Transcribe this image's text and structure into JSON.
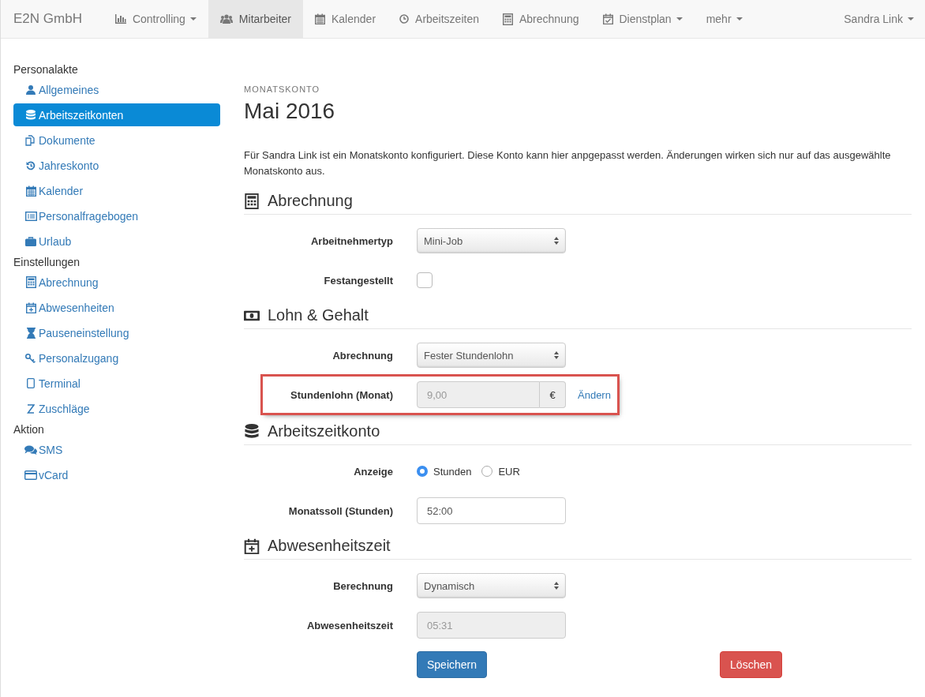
{
  "navbar": {
    "brand": "E2N GmbH",
    "items": [
      {
        "label": "Controlling",
        "dropdown": true,
        "selected": false
      },
      {
        "label": "Mitarbeiter",
        "dropdown": false,
        "selected": true
      },
      {
        "label": "Kalender",
        "dropdown": false,
        "selected": false
      },
      {
        "label": "Arbeitszeiten",
        "dropdown": false,
        "selected": false
      },
      {
        "label": "Abrechnung",
        "dropdown": false,
        "selected": false
      },
      {
        "label": "Dienstplan",
        "dropdown": true,
        "selected": false
      },
      {
        "label": "mehr",
        "dropdown": true,
        "selected": false
      }
    ],
    "user": {
      "label": "Sandra Link",
      "dropdown": true
    }
  },
  "sidebar": [
    {
      "heading": "Personalakte",
      "items": [
        {
          "label": "Allgemeines",
          "selected": false
        },
        {
          "label": "Arbeitszeitkonten",
          "selected": true
        },
        {
          "label": "Dokumente",
          "selected": false
        },
        {
          "label": "Jahreskonto",
          "selected": false
        },
        {
          "label": "Kalender",
          "selected": false
        },
        {
          "label": "Personalfragebogen",
          "selected": false
        },
        {
          "label": "Urlaub",
          "selected": false
        }
      ]
    },
    {
      "heading": "Einstellungen",
      "items": [
        {
          "label": "Abrechnung",
          "selected": false
        },
        {
          "label": "Abwesenheiten",
          "selected": false
        },
        {
          "label": "Pauseneinstellung",
          "selected": false
        },
        {
          "label": "Personalzugang",
          "selected": false
        },
        {
          "label": "Terminal",
          "selected": false
        },
        {
          "label": "Zuschläge",
          "selected": false
        }
      ]
    },
    {
      "heading": "Aktion",
      "items": [
        {
          "label": "SMS",
          "selected": false
        },
        {
          "label": "vCard",
          "selected": false
        }
      ]
    }
  ],
  "page": {
    "overline": "MONATSKONTO",
    "title": "Mai 2016",
    "intro": "Für Sandra Link ist ein Monatskonto konfiguriert. Diese Konto kann hier anpgepasst werden. Änderungen wirken sich nur auf das ausgewählte Monatskonto aus."
  },
  "sections": [
    {
      "title": "Abrechnung",
      "rows": [
        {
          "kind": "select",
          "label": "Arbeitnehmertyp",
          "value": "Mini-Job"
        },
        {
          "kind": "checkbox",
          "label": "Festangestellt",
          "checked": false
        }
      ]
    },
    {
      "title": "Lohn & Gehalt",
      "rows": [
        {
          "kind": "select",
          "label": "Abrechnung",
          "value": "Fester Stundenlohn"
        },
        {
          "kind": "addon",
          "label": "Stundenlohn (Monat)",
          "value": "9,00",
          "addon": "€",
          "link": "Ändern",
          "highlighted": true,
          "disabled": true
        }
      ]
    },
    {
      "title": "Arbeitszeitkonto",
      "rows": [
        {
          "kind": "radio",
          "label": "Anzeige",
          "options": [
            {
              "label": "Stunden",
              "selected": true
            },
            {
              "label": "EUR",
              "selected": false
            }
          ]
        },
        {
          "kind": "input",
          "label": "Monatssoll (Stunden)",
          "value": "52:00",
          "disabled": false
        }
      ]
    },
    {
      "title": "Abwesenheitszeit",
      "rows": [
        {
          "kind": "select",
          "label": "Berechnung",
          "value": "Dynamisch"
        },
        {
          "kind": "input",
          "label": "Abwesenheitszeit",
          "value": "05:31",
          "disabled": true
        }
      ]
    }
  ],
  "actions": {
    "save": "Speichern",
    "delete": "Löschen"
  }
}
